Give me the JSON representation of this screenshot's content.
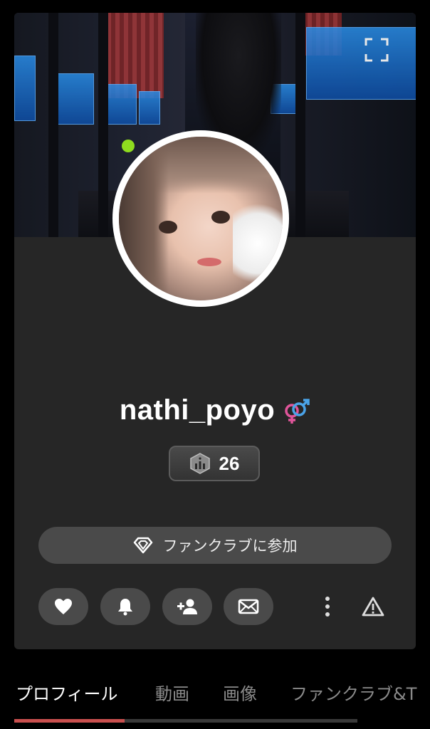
{
  "profile": {
    "username": "nathi_poyo",
    "online": true,
    "level": "26",
    "gender_icon": "gender-fluid-icon"
  },
  "fanclub": {
    "join_label": "ファンクラブに参加"
  },
  "actions": [
    {
      "name": "like-button",
      "icon": "heart-icon"
    },
    {
      "name": "notify-button",
      "icon": "bell-icon"
    },
    {
      "name": "follow-button",
      "icon": "add-user-icon"
    },
    {
      "name": "message-button",
      "icon": "mail-icon"
    },
    {
      "name": "more-button",
      "icon": "more-vertical-icon"
    },
    {
      "name": "report-button",
      "icon": "warning-icon"
    }
  ],
  "tabs": [
    {
      "label": "プロフィール",
      "active": true
    },
    {
      "label": "動画",
      "active": false
    },
    {
      "label": "画像",
      "active": false
    },
    {
      "label": "ファンクラブ&T",
      "active": false
    }
  ],
  "colors": {
    "background": "#000000",
    "card": "#262626",
    "button": "#4a4a4a",
    "online_dot": "#8fdc1f",
    "tab_indicator": "#c9504f"
  }
}
